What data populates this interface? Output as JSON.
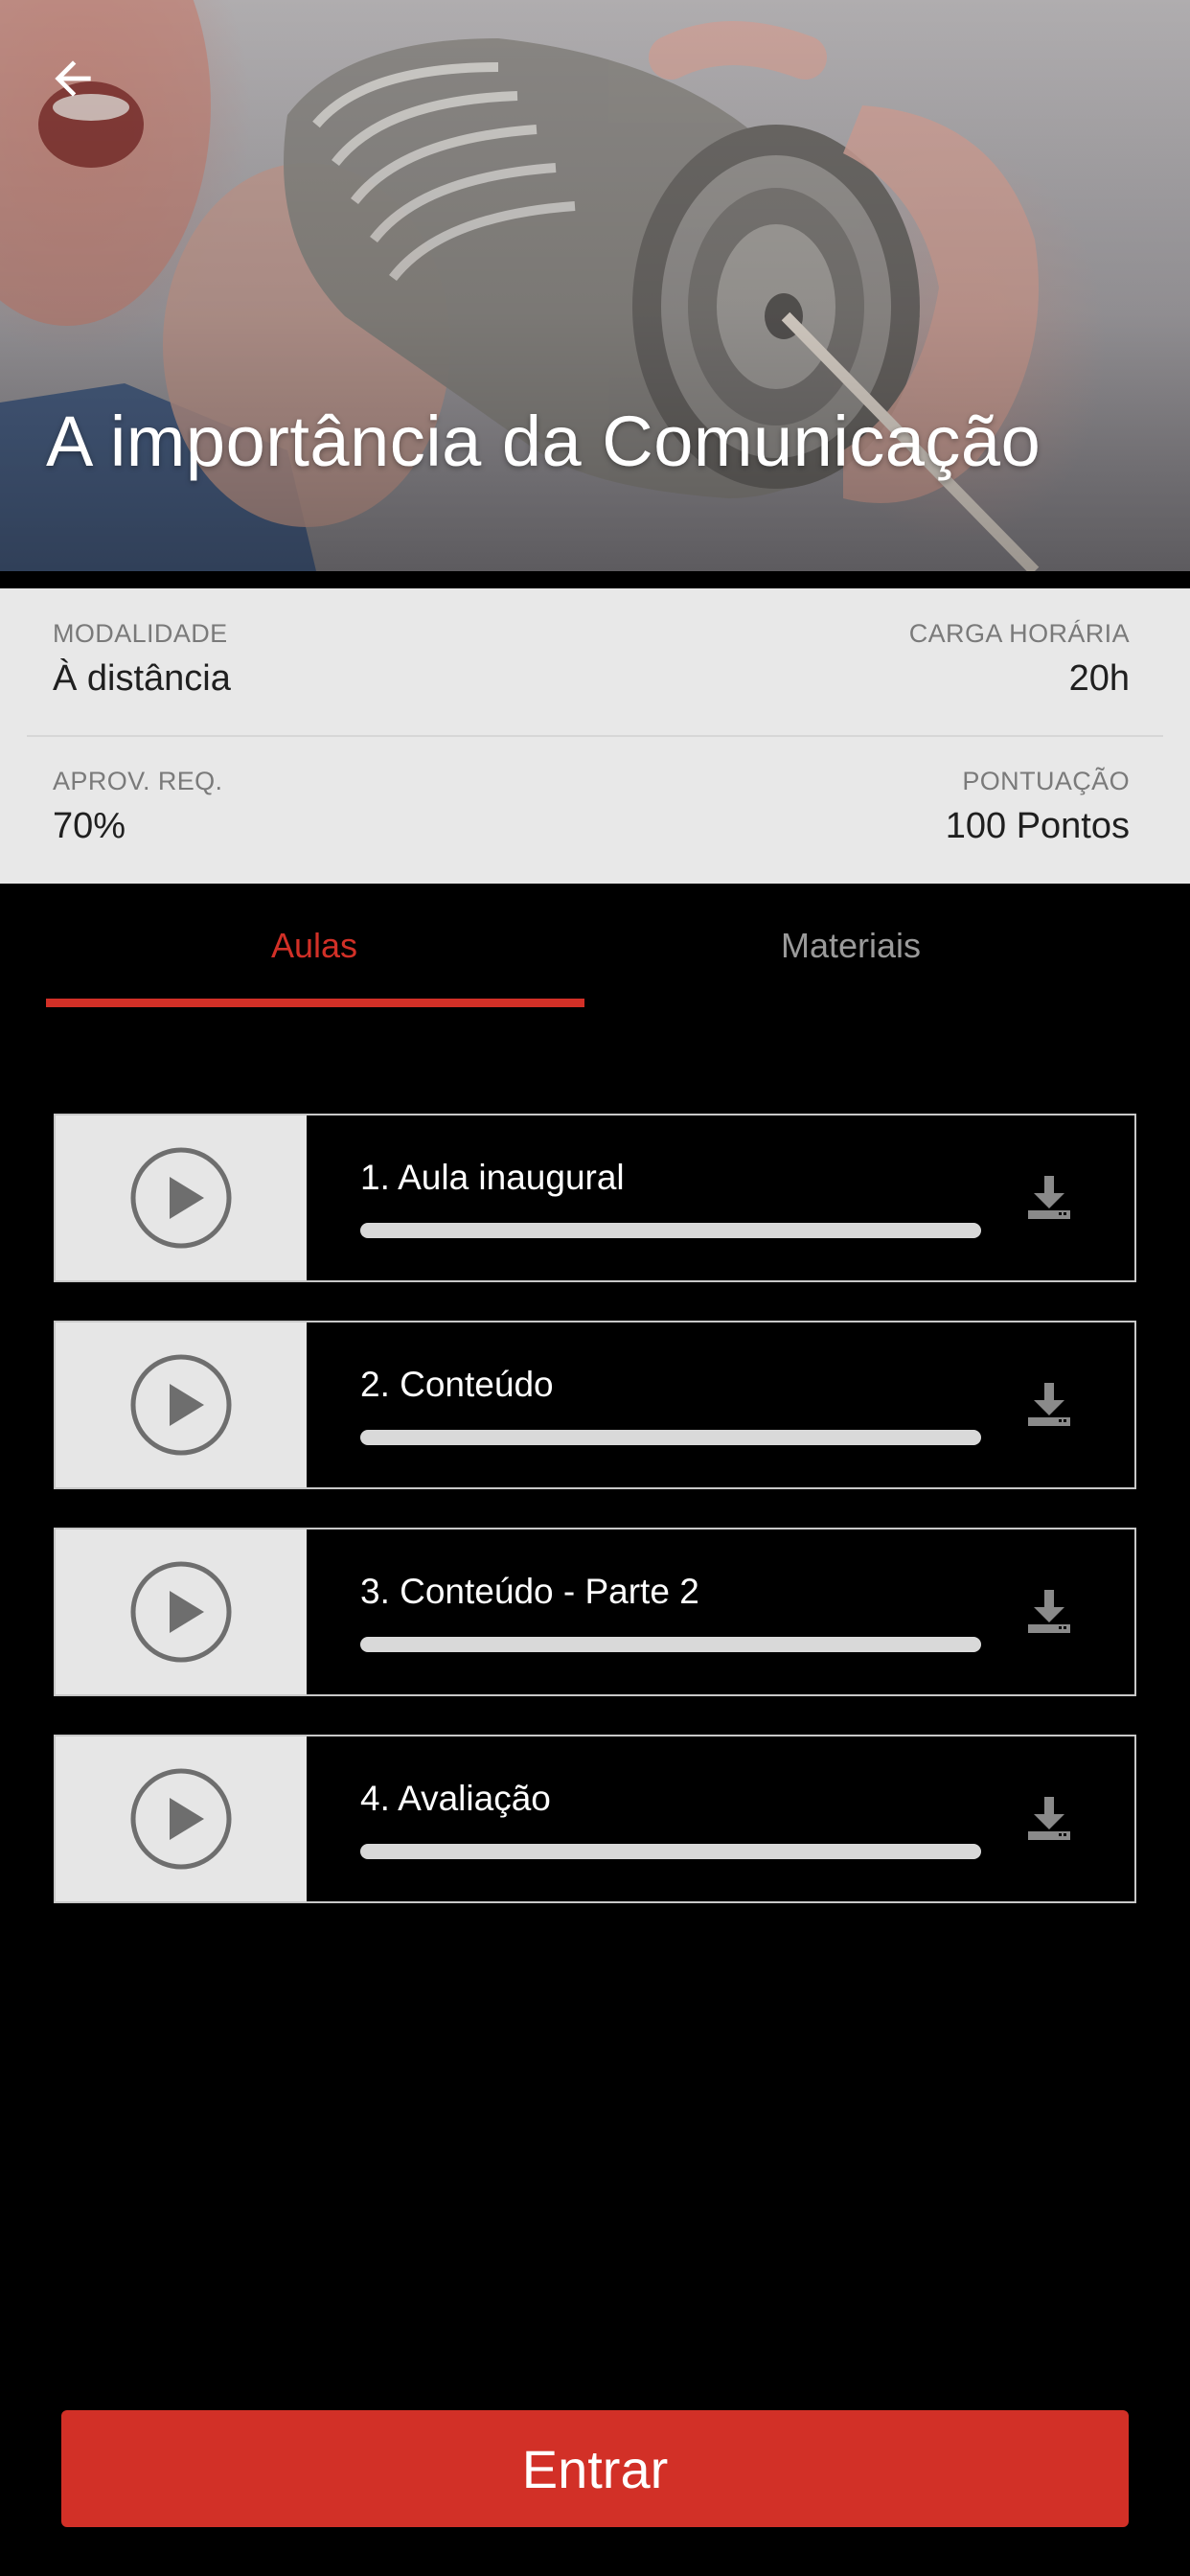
{
  "hero": {
    "title": "A importância da Comunicação",
    "back_icon": "arrow-left-icon",
    "image": "tin-can-phone-photo"
  },
  "info": {
    "modalidade": {
      "label": "MODALIDADE",
      "value": "À distância"
    },
    "carga_horaria": {
      "label": "CARGA HORÁRIA",
      "value": "20h"
    },
    "aprov_req": {
      "label": "APROV. REQ.",
      "value": "70%"
    },
    "pontuacao": {
      "label": "PONTUAÇÃO",
      "value": "100 Pontos"
    }
  },
  "tabs": [
    {
      "label": "Aulas",
      "active": true
    },
    {
      "label": "Materiais",
      "active": false
    }
  ],
  "lessons": [
    {
      "title": "1. Aula inaugural",
      "progress": 0
    },
    {
      "title": "2. Conteúdo",
      "progress": 0
    },
    {
      "title": "3. Conteúdo - Parte 2",
      "progress": 0
    },
    {
      "title": "4. Avaliação",
      "progress": 0
    }
  ],
  "icons": {
    "play": "play-circle-icon",
    "download": "download-icon"
  },
  "actions": {
    "enter_label": "Entrar"
  },
  "colors": {
    "accent": "#d23027",
    "background": "#000000",
    "info_card": "#e8e8e8",
    "thumb": "#e6e6e6",
    "progress_track": "#d9d9d9"
  }
}
